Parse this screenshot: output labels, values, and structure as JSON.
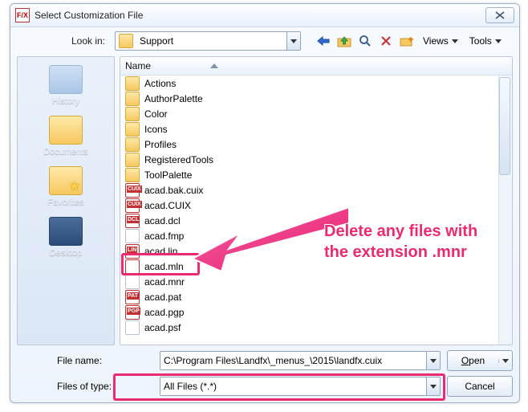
{
  "window": {
    "title": "Select Customization File"
  },
  "toprow": {
    "lookin_label": "Look in:",
    "lookin_value": "Support",
    "views_label": "Views",
    "tools_label": "Tools"
  },
  "places": [
    {
      "label": "History",
      "cls": "history"
    },
    {
      "label": "Documents",
      "cls": "folder"
    },
    {
      "label": "Favorites",
      "cls": "folder star"
    },
    {
      "label": "Desktop",
      "cls": "desktop"
    }
  ],
  "columns": {
    "name": "Name"
  },
  "files": [
    {
      "name": "Actions",
      "kind": "folder"
    },
    {
      "name": "AuthorPalette",
      "kind": "folder"
    },
    {
      "name": "Color",
      "kind": "folder"
    },
    {
      "name": "Icons",
      "kind": "folder"
    },
    {
      "name": "Profiles",
      "kind": "folder"
    },
    {
      "name": "RegisteredTools",
      "kind": "folder"
    },
    {
      "name": "ToolPalette",
      "kind": "folder"
    },
    {
      "name": "acad.bak.cuix",
      "kind": "badge",
      "badge": "CUIX"
    },
    {
      "name": "acad.CUIX",
      "kind": "badge",
      "badge": "CUIX"
    },
    {
      "name": "acad.dcl",
      "kind": "badge",
      "badge": "DCL"
    },
    {
      "name": "acad.fmp",
      "kind": "file"
    },
    {
      "name": "acad.lin",
      "kind": "badge",
      "badge": "LIN"
    },
    {
      "name": "acad.mln",
      "kind": "badge",
      "badge": ""
    },
    {
      "name": "acad.mnr",
      "kind": "file"
    },
    {
      "name": "acad.pat",
      "kind": "badge",
      "badge": "PAT"
    },
    {
      "name": "acad.pgp",
      "kind": "badge",
      "badge": "PGP"
    },
    {
      "name": "acad.psf",
      "kind": "file"
    }
  ],
  "bottom": {
    "filename_label": "File name:",
    "filename_value": "C:\\Program Files\\Landfx\\_menus_\\2015\\landfx.cuix",
    "filetype_label": "Files of type:",
    "filetype_value": "All Files (*.*)",
    "open_label": "Open",
    "cancel_label": "Cancel"
  },
  "annotation": {
    "line1": "Delete any files with",
    "line2": "the extension .mnr"
  }
}
